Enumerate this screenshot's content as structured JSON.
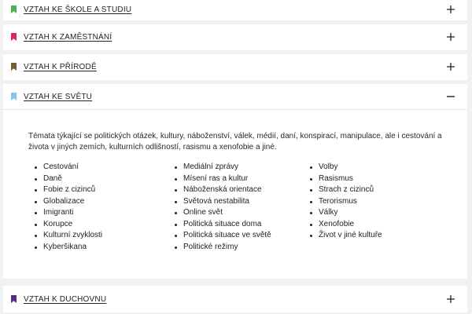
{
  "accent_colors": {
    "skola": "#4caf50",
    "zamestnani": "#e0245e",
    "priroda": "#7b5a3a",
    "svet": "#7fc8f0",
    "duchovno": "#5b2a86"
  },
  "sections": [
    {
      "id": "skola",
      "title": "VZTAH KE ŠKOLE A STUDIU",
      "icon": "bookmark-icon",
      "toggle": "plus-icon",
      "expanded": false
    },
    {
      "id": "zamestnani",
      "title": "VZTAH K ZAMĚSTNÁNÍ",
      "icon": "bookmark-icon",
      "toggle": "plus-icon",
      "expanded": false
    },
    {
      "id": "priroda",
      "title": "VZTAH K PŘÍRODĚ",
      "icon": "bookmark-icon",
      "toggle": "plus-icon",
      "expanded": false
    },
    {
      "id": "svet",
      "title": "VZTAH KE SVĚTU",
      "icon": "bookmark-icon",
      "toggle": "minus-icon",
      "expanded": true
    },
    {
      "id": "duchovno",
      "title": "VZTAH K DUCHOVNU",
      "icon": "bookmark-icon",
      "toggle": "plus-icon",
      "expanded": false
    }
  ],
  "svet_content": {
    "intro": "Témata týkající se politických otázek, kultury, náboženství, válek, médií, daní, konspirací, manipulace, ale i cestování a života v jiných zemích, kulturních odlišností, rasismu a xenofobie a jiné.",
    "col1": [
      "Cestování",
      "Daně",
      "Fobie z cizinců",
      "Globalizace",
      "Imigranti",
      "Korupce",
      "Kulturní zvyklosti",
      "Kyberšikana"
    ],
    "col2": [
      "Mediální zprávy",
      "Mísení ras a kultur",
      "Náboženská orientace",
      "Světová nestabilita",
      "Online svět",
      "Politická situace doma",
      "Politická situace ve světě",
      "Politické režimy"
    ],
    "col3": [
      "Volby",
      "Rasismus",
      "Strach z cizinců",
      "Terorismus",
      "Války",
      "Xenofobie",
      "Život v jiné kultuře"
    ]
  }
}
